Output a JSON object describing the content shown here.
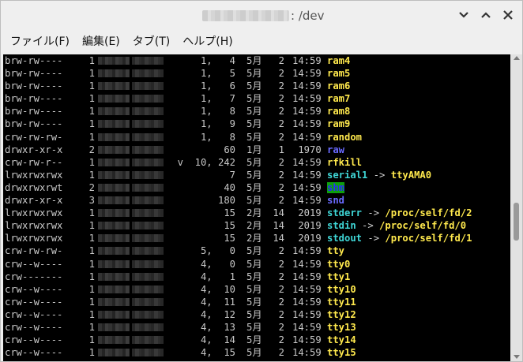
{
  "window": {
    "title_suffix": ": /dev"
  },
  "menu": [
    {
      "label": "ファイル(F)"
    },
    {
      "label": "編集(E)"
    },
    {
      "label": "タブ(T)"
    },
    {
      "label": "ヘルプ(H)"
    }
  ],
  "icons": {
    "close": "close-icon",
    "maximize": "maximize-icon",
    "minimize": "minimize-icon"
  },
  "colors": {
    "terminal_bg": "#000000",
    "device_yellow": "#ffe94d",
    "dir_blue": "#6a6aff",
    "link_cyan": "#3fd6d6",
    "shm_highlight": "#0e9f0e"
  },
  "listing": [
    {
      "perm": "brw-rw----",
      "links": "1",
      "size": "1,   4",
      "month": "5月",
      "day": "2",
      "time": "14:59",
      "name": "ram4",
      "type": "device"
    },
    {
      "perm": "brw-rw----",
      "links": "1",
      "size": "1,   5",
      "month": "5月",
      "day": "2",
      "time": "14:59",
      "name": "ram5",
      "type": "device"
    },
    {
      "perm": "brw-rw----",
      "links": "1",
      "size": "1,   6",
      "month": "5月",
      "day": "2",
      "time": "14:59",
      "name": "ram6",
      "type": "device"
    },
    {
      "perm": "brw-rw----",
      "links": "1",
      "size": "1,   7",
      "month": "5月",
      "day": "2",
      "time": "14:59",
      "name": "ram7",
      "type": "device"
    },
    {
      "perm": "brw-rw----",
      "links": "1",
      "size": "1,   8",
      "month": "5月",
      "day": "2",
      "time": "14:59",
      "name": "ram8",
      "type": "device"
    },
    {
      "perm": "brw-rw----",
      "links": "1",
      "size": "1,   9",
      "month": "5月",
      "day": "2",
      "time": "14:59",
      "name": "ram9",
      "type": "device"
    },
    {
      "perm": "crw-rw-rw-",
      "links": "1",
      "size": "1,   8",
      "month": "5月",
      "day": "2",
      "time": "14:59",
      "name": "random",
      "type": "device"
    },
    {
      "perm": "drwxr-xr-x",
      "links": "2",
      "size": "60",
      "month": "1月",
      "day": "1",
      "time": " 1970",
      "name": "raw",
      "type": "dir"
    },
    {
      "perm": "crw-rw-r--",
      "links": "1",
      "size": "v  10, 242",
      "month": "5月",
      "day": "2",
      "time": "14:59",
      "name": "rfkill",
      "type": "device"
    },
    {
      "perm": "lrwxrwxrwx",
      "links": "1",
      "size": "7",
      "month": "5月",
      "day": "2",
      "time": "14:59",
      "name": "serial1",
      "target": "ttyAMA0",
      "type": "link"
    },
    {
      "perm": "drwxrwxrwt",
      "links": "2",
      "size": "40",
      "month": "5月",
      "day": "2",
      "time": "14:59",
      "name": "shm",
      "type": "shm"
    },
    {
      "perm": "drwxr-xr-x",
      "links": "3",
      "size": "180",
      "month": "5月",
      "day": "2",
      "time": "14:59",
      "name": "snd",
      "type": "dir"
    },
    {
      "perm": "lrwxrwxrwx",
      "links": "1",
      "size": "15",
      "month": "2月",
      "day": "14",
      "time": " 2019",
      "name": "stderr",
      "target": "/proc/self/fd/2",
      "type": "link"
    },
    {
      "perm": "lrwxrwxrwx",
      "links": "1",
      "size": "15",
      "month": "2月",
      "day": "14",
      "time": " 2019",
      "name": "stdin",
      "target": "/proc/self/fd/0",
      "type": "link"
    },
    {
      "perm": "lrwxrwxrwx",
      "links": "1",
      "size": "15",
      "month": "2月",
      "day": "14",
      "time": " 2019",
      "name": "stdout",
      "target": "/proc/self/fd/1",
      "type": "link"
    },
    {
      "perm": "crw-rw-rw-",
      "links": "1",
      "size": "5,   0",
      "month": "5月",
      "day": "2",
      "time": "14:59",
      "name": "tty",
      "type": "device"
    },
    {
      "perm": "crw--w----",
      "links": "1",
      "size": "4,   0",
      "month": "5月",
      "day": "2",
      "time": "14:59",
      "name": "tty0",
      "type": "device"
    },
    {
      "perm": "crw-------",
      "links": "1",
      "size": "4,   1",
      "month": "5月",
      "day": "2",
      "time": "14:59",
      "name": "tty1",
      "type": "device"
    },
    {
      "perm": "crw--w----",
      "links": "1",
      "size": "4,  10",
      "month": "5月",
      "day": "2",
      "time": "14:59",
      "name": "tty10",
      "type": "device"
    },
    {
      "perm": "crw--w----",
      "links": "1",
      "size": "4,  11",
      "month": "5月",
      "day": "2",
      "time": "14:59",
      "name": "tty11",
      "type": "device"
    },
    {
      "perm": "crw--w----",
      "links": "1",
      "size": "4,  12",
      "month": "5月",
      "day": "2",
      "time": "14:59",
      "name": "tty12",
      "type": "device"
    },
    {
      "perm": "crw--w----",
      "links": "1",
      "size": "4,  13",
      "month": "5月",
      "day": "2",
      "time": "14:59",
      "name": "tty13",
      "type": "device"
    },
    {
      "perm": "crw--w----",
      "links": "1",
      "size": "4,  14",
      "month": "5月",
      "day": "2",
      "time": "14:59",
      "name": "tty14",
      "type": "device"
    },
    {
      "perm": "crw--w----",
      "links": "1",
      "size": "4,  15",
      "month": "5月",
      "day": "2",
      "time": "14:59",
      "name": "tty15",
      "type": "device"
    }
  ]
}
